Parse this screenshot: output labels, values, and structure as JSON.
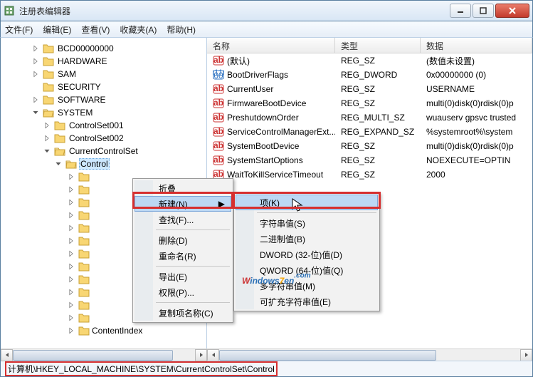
{
  "window": {
    "title": "注册表编辑器"
  },
  "menu": {
    "file": "文件(F)",
    "edit": "编辑(E)",
    "view": "查看(V)",
    "favorites": "收藏夹(A)",
    "help": "帮助(H)"
  },
  "tree": {
    "nodes": [
      {
        "label": "BCD00000000",
        "exp": "closed"
      },
      {
        "label": "HARDWARE",
        "exp": "closed"
      },
      {
        "label": "SAM",
        "exp": "closed"
      },
      {
        "label": "SECURITY",
        "exp": "none"
      },
      {
        "label": "SOFTWARE",
        "exp": "closed"
      },
      {
        "label": "SYSTEM",
        "exp": "open",
        "children": [
          {
            "label": "ControlSet001",
            "exp": "closed"
          },
          {
            "label": "ControlSet002",
            "exp": "closed"
          },
          {
            "label": "CurrentControlSet",
            "exp": "open",
            "children": [
              {
                "label": "Control",
                "exp": "open",
                "selected": true,
                "subcount": 13,
                "subnamed": {
                  "12": "ContentIndex"
                }
              }
            ]
          }
        ]
      }
    ]
  },
  "listhead": {
    "name": "名称",
    "type": "类型",
    "data": "数据"
  },
  "values": [
    {
      "icon": "str",
      "name": "(默认)",
      "type": "REG_SZ",
      "data": "(数值未设置)"
    },
    {
      "icon": "bin",
      "name": "BootDriverFlags",
      "type": "REG_DWORD",
      "data": "0x00000000 (0)"
    },
    {
      "icon": "str",
      "name": "CurrentUser",
      "type": "REG_SZ",
      "data": "USERNAME"
    },
    {
      "icon": "str",
      "name": "FirmwareBootDevice",
      "type": "REG_SZ",
      "data": "multi(0)disk(0)rdisk(0)p"
    },
    {
      "icon": "str",
      "name": "PreshutdownOrder",
      "type": "REG_MULTI_SZ",
      "data": "wuauserv gpsvc trusted"
    },
    {
      "icon": "str",
      "name": "ServiceControlManagerExt...",
      "type": "REG_EXPAND_SZ",
      "data": "%systemroot%\\system"
    },
    {
      "icon": "str",
      "name": "SystemBootDevice",
      "type": "REG_SZ",
      "data": "multi(0)disk(0)rdisk(0)p"
    },
    {
      "icon": "str",
      "name": "SystemStartOptions",
      "type": "REG_SZ",
      "data": " NOEXECUTE=OPTIN"
    },
    {
      "icon": "str",
      "name": "WaitToKillServiceTimeout",
      "type": "REG_SZ",
      "data": "2000"
    }
  ],
  "ctx1": {
    "collapse": "折叠",
    "new": "新建(N)",
    "find": "查找(F)...",
    "delete": "删除(D)",
    "rename": "重命名(R)",
    "export": "导出(E)",
    "perms": "权限(P)...",
    "copyname": "复制项名称(C)"
  },
  "ctx2": {
    "key": "项(K)",
    "string": "字符串值(S)",
    "binary": "二进制值(B)",
    "dword": "DWORD (32-位)值(D)",
    "qword": "QWORD (64-位)值(Q)",
    "multi": "多字符串值(M)",
    "expand": "可扩充字符串值(E)"
  },
  "statusbar": {
    "path": "计算机\\HKEY_LOCAL_MACHINE\\SYSTEM\\CurrentControlSet\\Control"
  },
  "watermark": {
    "w": "W",
    "indows": "indows",
    "seven": "7",
    "en": "en",
    "com": ".com"
  }
}
